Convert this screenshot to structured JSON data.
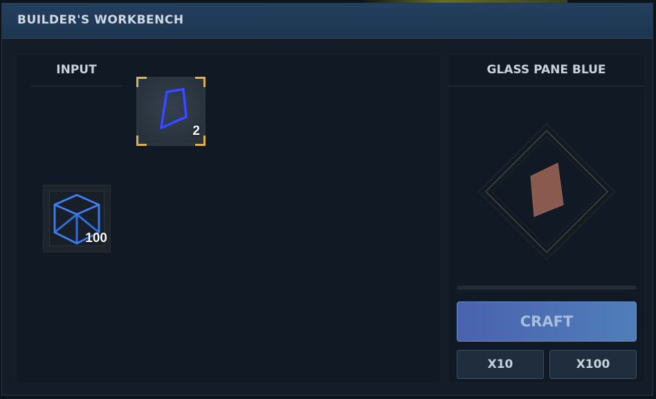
{
  "window": {
    "title": "BUILDER'S WORKBENCH"
  },
  "input_panel": {
    "header": "INPUT",
    "recipe_slot": {
      "icon": "glass-pane-icon",
      "count": "2",
      "selected": true
    },
    "resource_slot": {
      "icon": "frame-cube-icon",
      "count": "100"
    }
  },
  "output_panel": {
    "header": "GLASS PANE BLUE",
    "preview_icon": "glass-pane-preview-icon",
    "progress": 0,
    "craft_label": "CRAFT",
    "x10_label": "X10",
    "x100_label": "X100"
  },
  "colors": {
    "titlebar": "#1d3550",
    "accent_gold": "#e0b14a",
    "craft_button": "#4f6fb5",
    "glass_blue": "#2b3dff",
    "preview_glass": "#8a5a4f"
  }
}
